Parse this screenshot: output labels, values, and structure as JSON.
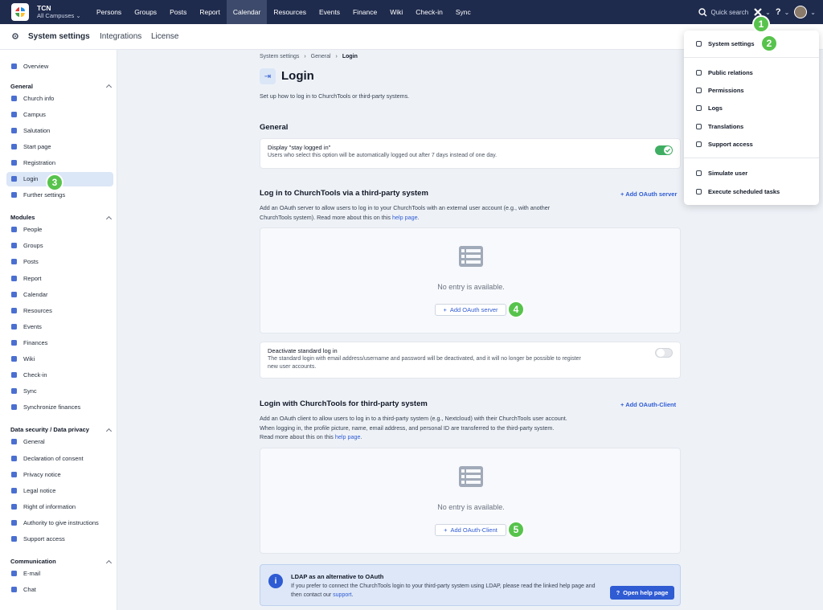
{
  "app": {
    "org_name": "TCN",
    "campus": "All Campuses"
  },
  "nav": [
    "Persons",
    "Groups",
    "Posts",
    "Report",
    "Calendar",
    "Resources",
    "Events",
    "Finance",
    "Wiki",
    "Check-in",
    "Sync"
  ],
  "active_nav": "Calendar",
  "quick_search": "Quick search",
  "help_icon": "?",
  "subnav": {
    "title": "System settings",
    "tabs": [
      "Integrations",
      "License"
    ]
  },
  "sidebar": {
    "overview": "Overview",
    "sections": [
      {
        "title": "General",
        "items": [
          "Church info",
          "Campus",
          "Salutation",
          "Start page",
          "Registration",
          "Login",
          "Further settings"
        ]
      },
      {
        "title": "Modules",
        "items": [
          "People",
          "Groups",
          "Posts",
          "Report",
          "Calendar",
          "Resources",
          "Events",
          "Finances",
          "Wiki",
          "Check-in",
          "Sync",
          "Synchronize finances"
        ]
      },
      {
        "title": "Data security / Data privacy",
        "items": [
          "General",
          "Declaration of consent",
          "Privacy notice",
          "Legal notice",
          "Right of information",
          "Authority to give instructions",
          "Support access"
        ]
      },
      {
        "title": "Communication",
        "items": [
          "E-mail",
          "Chat"
        ]
      }
    ],
    "active_item": "Login"
  },
  "breadcrumb": [
    "System settings",
    "General",
    "Login"
  ],
  "page": {
    "title": "Login",
    "description": "Set up how to log in to ChurchTools or third-party systems."
  },
  "general_heading": "General",
  "stay_logged": {
    "title": "Display \"stay logged in\"",
    "desc": "Users who select this option will be automatically logged out after 7 days instead of one day.",
    "enabled": true
  },
  "oauth": {
    "heading": "Log in to ChurchTools via a third-party system",
    "add_label": "Add OAuth server",
    "desc_main": "Add an OAuth server to allow users to log in to your ChurchTools with an external user account (e.g., with another ChurchTools system). Read more about this on this",
    "desc_link": "help page",
    "empty_text": "No entry is available.",
    "button_label": "Add OAuth server"
  },
  "deactivate": {
    "title": "Deactivate standard log in",
    "desc": "The standard login with email address/username and password will be deactivated, and it will no longer be possible to register new user accounts.",
    "enabled": false
  },
  "oauth_client": {
    "heading": "Login with ChurchTools for third-party system",
    "add_label": "Add OAuth-Client",
    "desc_main": "Add an OAuth client to allow users to log in to a third-party system (e.g., Nextcloud) with their ChurchTools user account. When logging in, the profile picture, name, email address, and personal ID are transferred to the third-party system. Read more about this on this",
    "desc_link": "help page",
    "empty_text": "No entry is available.",
    "button_label": "Add OAuth-Client"
  },
  "ldap": {
    "title": "LDAP as an alternative to OAuth",
    "desc": "If you prefer to connect the ChurchTools login to your third-party system using LDAP, please read the linked help page and then contact our",
    "link": "support",
    "button": "Open help page"
  },
  "menu": {
    "group1": [
      "System settings"
    ],
    "group2": [
      "Public relations",
      "Permissions",
      "Logs",
      "Translations",
      "Support access"
    ],
    "group3": [
      "Simulate user",
      "Execute scheduled tasks"
    ]
  },
  "badges": [
    "1",
    "2",
    "3",
    "4",
    "5"
  ],
  "colors": {
    "topbar": "#1f2b4d",
    "accent": "#2f5bd3",
    "badge": "#57c34c",
    "toggle_on": "#3fae62"
  }
}
